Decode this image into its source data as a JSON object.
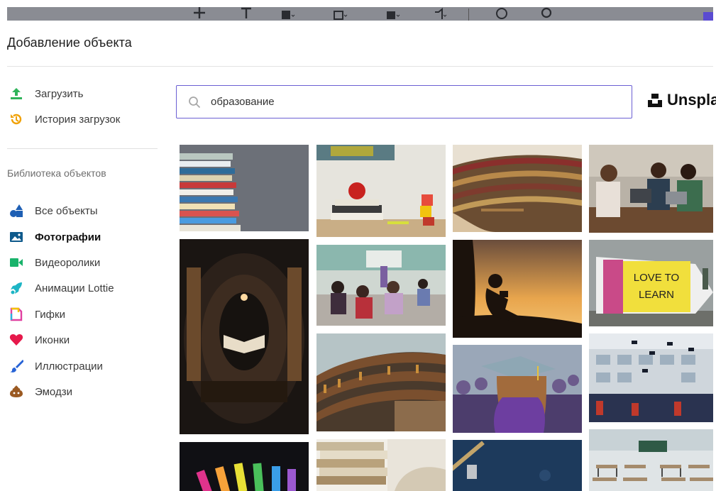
{
  "dialog": {
    "title": "Добавление объекта"
  },
  "sidebar": {
    "upload": {
      "label": "Загрузить",
      "icon": "upload-icon",
      "color": "#2fb45a"
    },
    "history": {
      "label": "История загрузок",
      "icon": "history-icon",
      "color": "#f0a000"
    },
    "library_label": "Библиотека объектов",
    "items": [
      {
        "label": "Все объекты",
        "icon": "shapes-icon",
        "active": false
      },
      {
        "label": "Фотографии",
        "icon": "photo-icon",
        "active": true
      },
      {
        "label": "Видеоролики",
        "icon": "video-icon",
        "active": false
      },
      {
        "label": "Анимации Lottie",
        "icon": "rocket-icon",
        "active": false
      },
      {
        "label": "Гифки",
        "icon": "gif-icon",
        "active": false
      },
      {
        "label": "Иконки",
        "icon": "heart-icon",
        "active": false
      },
      {
        "label": "Иллюстрации",
        "icon": "brush-icon",
        "active": false
      },
      {
        "label": "Эмодзи",
        "icon": "poop-emoji-icon",
        "active": false
      }
    ]
  },
  "search": {
    "value": "образование",
    "placeholder": ""
  },
  "provider": {
    "name": "Unsplash"
  },
  "photos": [
    {
      "subject": "stack of colorful books"
    },
    {
      "subject": "apple on books with alphabet blocks"
    },
    {
      "subject": "curved library bookshelves"
    },
    {
      "subject": "students with laptops at table"
    },
    {
      "subject": "book among spiral bookshelves"
    },
    {
      "subject": "classroom with students"
    },
    {
      "subject": "silhouette reading at sunset"
    },
    {
      "subject": "love to learn pencil"
    },
    {
      "subject": "library shelves curve"
    },
    {
      "subject": "graduate with cap"
    },
    {
      "subject": "graduates throwing caps"
    },
    {
      "subject": "colorful chalk"
    },
    {
      "subject": "stacked books"
    },
    {
      "subject": "blue desk with tools"
    },
    {
      "subject": "empty classroom"
    }
  ],
  "colors": {
    "accent": "#6b5fd3",
    "toolbar": "#8a8c93"
  }
}
